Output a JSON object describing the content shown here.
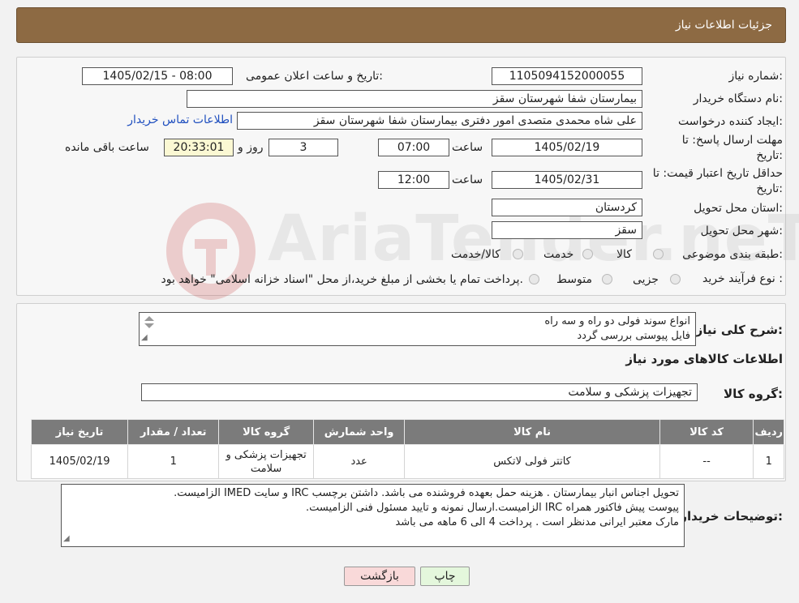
{
  "header": {
    "title": "جزئیات اطلاعات نیاز"
  },
  "form": {
    "need_number_label": "شماره نیاز:",
    "need_number": "1105094152000055",
    "announce_label": "تاریخ و ساعت اعلان عمومی:",
    "announce_value": "1405/02/15 - 08:00",
    "buyer_org_label": "نام دستگاه خریدار:",
    "buyer_org": "بیمارستان شفا شهرستان سقز",
    "requester_label": "ایجاد کننده درخواست:",
    "requester": "علی شاه محمدی متصدی امور دفتری بیمارستان شفا شهرستان سقز",
    "contact_link": "اطلاعات تماس خریدار",
    "deadline_label": "مهلت ارسال پاسخ: تا تاریخ:",
    "deadline_date": "1405/02/19",
    "time_label": "ساعت",
    "deadline_time": "07:00",
    "days_value": "3",
    "days_label": "روز و",
    "remaining_time": "20:33:01",
    "remaining_label": "ساعت باقی مانده",
    "validity_label": "حداقل تاریخ اعتبار قیمت: تا تاریخ:",
    "validity_date": "1405/02/31",
    "validity_time": "12:00",
    "province_label": "استان محل تحویل:",
    "province": "کردستان",
    "city_label": "شهر محل تحویل:",
    "city": "سقز",
    "category_label": "طبقه بندی موضوعی:",
    "category_options": [
      "کالا",
      "خدمت",
      "کالا/خدمت"
    ],
    "purchase_type_label": "نوع فرآیند خرید :",
    "purchase_options": [
      "جزیی",
      "متوسط"
    ],
    "purchase_note": "پرداخت تمام یا بخشی از مبلغ خرید،از محل \"اسناد خزانه اسلامی\" خواهد بود."
  },
  "watermark": {
    "text": "AriaTender.neT"
  },
  "details": {
    "summary_label": "شرح کلی نیاز:",
    "summary_line1": "انواع سوند فولی دو راه و سه راه",
    "summary_line2": "فایل پیوستی بررسی گردد",
    "goods_info_title": "اطلاعات کالاهای مورد نیاز",
    "goods_group_label": "گروه کالا:",
    "goods_group": "تجهیزات پزشکی و سلامت"
  },
  "table": {
    "headers": [
      "ردیف",
      "کد کالا",
      "نام کالا",
      "واحد شمارش",
      "گروه کالا",
      "تعداد / مقدار",
      "تاریخ نیاز"
    ],
    "rows": [
      [
        "1",
        "--",
        "کاتتر فولی لاتکس",
        "عدد",
        "تجهیزات پزشکی و سلامت",
        "1",
        "1405/02/19"
      ]
    ]
  },
  "buyer_notes": {
    "label": "توضیحات خریدار:",
    "line1": "تحویل اجناس  انبار بیمارستان . هزینه حمل بعهده فروشنده می باشد.  داشتن برچسب IRC  و سایت  IMED  الزامیست.",
    "line2": "پیوست پیش فاکتور همراه IRC  الزامیست.ارسال نمونه و تایید مسئول فنی الزامیست.",
    "line3": "مارک معتبر ایرانی مدنظر است . پرداخت 4 الی 6 ماهه می باشد"
  },
  "buttons": {
    "print": "چاپ",
    "back": "بازگشت"
  },
  "colors": {
    "header_bg": "#8d6a43",
    "table_header_bg": "#7b7b7b",
    "remaining_bg": "#fbf8d3",
    "link": "#1f4fbf"
  }
}
